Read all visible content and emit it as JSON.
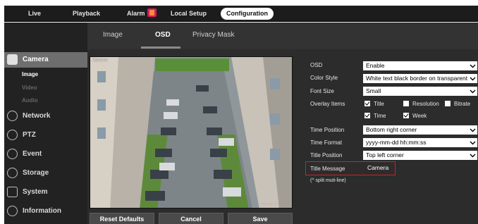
{
  "nav": {
    "live": "Live",
    "playback": "Playback",
    "alarm": "Alarm",
    "local_setup": "Local Setup",
    "configuration": "Configuration"
  },
  "sidebar": {
    "camera": "Camera",
    "camera_sub": [
      "Image",
      "Video",
      "Audio"
    ],
    "network": "Network",
    "ptz": "PTZ",
    "event": "Event",
    "storage": "Storage",
    "system": "System",
    "information": "Information"
  },
  "tabs": {
    "image": "Image",
    "osd": "OSD",
    "privacy_mask": "Privacy Mask"
  },
  "buttons": {
    "reset": "Reset Defaults",
    "cancel": "Cancel",
    "save": "Save"
  },
  "form": {
    "osd_label": "OSD",
    "osd_value": "Enable",
    "color_style_label": "Color Style",
    "color_style_value": "White text black border on transparent",
    "font_size_label": "Font Size",
    "font_size_value": "Small",
    "overlay_label": "Overlay Items",
    "overlay_items": [
      {
        "label": "Title",
        "checked": true
      },
      {
        "label": "Resolution",
        "checked": false
      },
      {
        "label": "Bitrate",
        "checked": false
      },
      {
        "label": "Time",
        "checked": true
      },
      {
        "label": "Week",
        "checked": true
      }
    ],
    "time_position_label": "Time Position",
    "time_position_value": "Bottom right corner",
    "time_format_label": "Time Format",
    "time_format_value": "yyyy-mm-dd hh:mm:ss",
    "title_position_label": "Title Position",
    "title_position_value": "Top left corner",
    "title_message_label": "Title Message",
    "title_message_value": "Camera",
    "hint": "(^ split muti-line)"
  },
  "colors": {
    "highlight_box": "#d0202a",
    "active_nav_bg": "#ffffff",
    "sidebar_active": "#6e6e6e"
  }
}
